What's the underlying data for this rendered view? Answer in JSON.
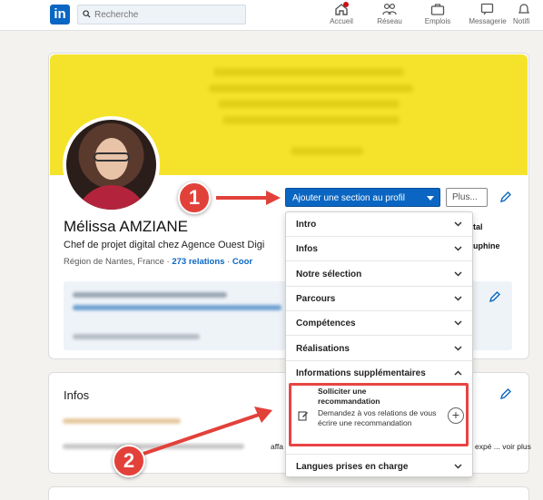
{
  "nav": {
    "logo": "in",
    "search_placeholder": "Recherche",
    "items": [
      {
        "label": "Accueil",
        "icon": "home-icon"
      },
      {
        "label": "Réseau",
        "icon": "network-icon"
      },
      {
        "label": "Emplois",
        "icon": "briefcase-icon"
      },
      {
        "label": "Messagerie",
        "icon": "messaging-icon"
      },
      {
        "label": "Notifi",
        "icon": "bell-icon"
      }
    ]
  },
  "profile": {
    "name": "Mélissa AMZIANE",
    "headline": "Chef de projet digital chez Agence Ouest Digi",
    "location": "Région de Nantes, France",
    "separator": "·",
    "connections": "273 relations",
    "contact": "Coor",
    "side_text_1": "tal",
    "side_text_2": "uphine"
  },
  "actions": {
    "add_section": "Ajouter une section au profil",
    "more": "Plus..."
  },
  "dropdown": {
    "items": [
      "Intro",
      "Infos",
      "Notre sélection",
      "Parcours",
      "Compétences",
      "Réalisations",
      "Informations supplémentaires"
    ],
    "sub_item": {
      "title": "Solliciter une recommandation",
      "description": "Demandez à vos relations de vous écrire une recommandation"
    },
    "last_item": "Langues prises en charge"
  },
  "infos": {
    "title": "Infos",
    "trail_1": "affa",
    "trail_2": "expé ... voir plus"
  },
  "steps": [
    "1",
    "2"
  ],
  "colors": {
    "brand": "#0a66c2",
    "cover": "#f5e32b",
    "annotation": "#e2413a"
  }
}
